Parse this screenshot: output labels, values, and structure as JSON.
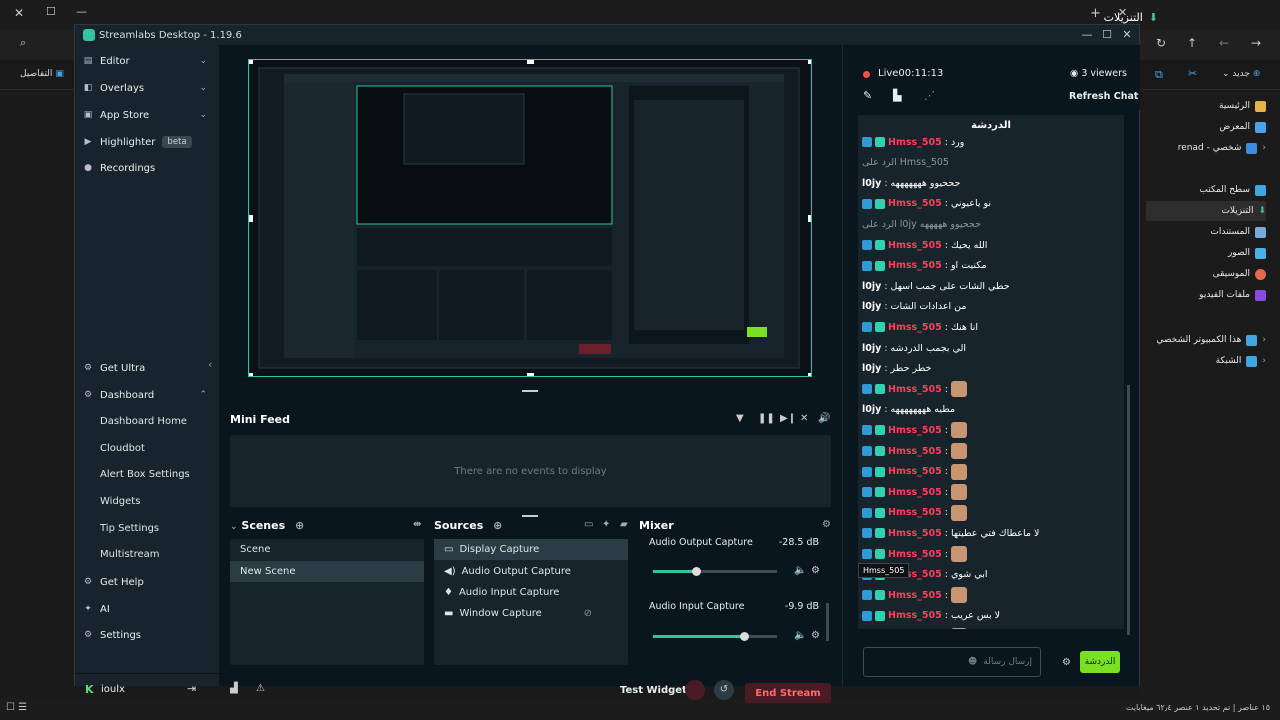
{
  "explorer": {
    "tab_title": "التنزيلات",
    "toolbar_new": "جديد",
    "details_label": "التفاصيل",
    "sidebar": [
      {
        "label": "الرئيسية"
      },
      {
        "label": "المعرض"
      },
      {
        "label": "renad - شخصي"
      },
      {
        "label": "سطح المكتب"
      },
      {
        "label": "التنزيلات"
      },
      {
        "label": "المستندات"
      },
      {
        "label": "الصور"
      },
      {
        "label": "الموسيقى"
      },
      {
        "label": "ملفات الفيديو"
      },
      {
        "label": "هذا الكمبيوتر الشخصي"
      },
      {
        "label": "الشبكة"
      }
    ],
    "status": "١٥ عناصر  |  تم تحديد ١ عنصر ٦٢٫٤ ميغابايت"
  },
  "app": {
    "title": "Streamlabs Desktop - 1.19.6",
    "nav": {
      "editor": "Editor",
      "overlays": "Overlays",
      "app_store": "App Store",
      "highlighter": "Highlighter",
      "beta": "beta",
      "recordings": "Recordings",
      "get_ultra": "Get Ultra",
      "dashboard": "Dashboard",
      "dashboard_sub": [
        "Dashboard Home",
        "Cloudbot",
        "Alert Box Settings",
        "Widgets",
        "Tip Settings",
        "Multistream"
      ],
      "get_help": "Get Help",
      "ai": "AI",
      "settings": "Settings",
      "user": "ioulx"
    },
    "minifeed": {
      "title": "Mini Feed",
      "empty": "There are no events to display"
    },
    "scenes": {
      "title": "Scenes",
      "items": [
        {
          "label": "Scene"
        },
        {
          "label": "New Scene"
        }
      ]
    },
    "sources": {
      "title": "Sources",
      "items": [
        {
          "label": "Display Capture"
        },
        {
          "label": "Audio Output Capture"
        },
        {
          "label": "Audio Input Capture"
        },
        {
          "label": "Window Capture"
        }
      ]
    },
    "mixer": {
      "title": "Mixer",
      "channels": [
        {
          "label": "Audio Output Capture",
          "db": "-28.5 dB",
          "level": 0.35
        },
        {
          "label": "Audio Input Capture",
          "db": "-9.9 dB",
          "level": 0.73
        }
      ]
    },
    "footer": {
      "test_widgets": "Test Widgets",
      "end_stream": "End Stream"
    }
  },
  "chat": {
    "live": "Live",
    "time": "00:11:13",
    "viewers": "3 viewers",
    "refresh": "Refresh Chat",
    "title": "الدردشة",
    "messages": [
      {
        "user": "Hmss_505",
        "text": "ورد"
      },
      {
        "user": "",
        "text": "الرد على Hmss_505"
      },
      {
        "user": "l0jy",
        "text": "حححيوو هههههههه"
      },
      {
        "user": "Hmss_505",
        "text": "نو ياعيوني"
      },
      {
        "user": "",
        "text": "الرد على l0jy حححيوو هههههه"
      },
      {
        "user": "Hmss_505",
        "text": "الله يحيك"
      },
      {
        "user": "Hmss_505",
        "text": "مكنيت او"
      },
      {
        "user": "l0jy",
        "text": "حطي الشات على جمب اسهل"
      },
      {
        "user": "l0jy",
        "text": "من اعدادات الشات"
      },
      {
        "user": "Hmss_505",
        "text": "انا هنك"
      },
      {
        "user": "l0jy",
        "text": "الي بجمب الدردشه"
      },
      {
        "user": "l0jy",
        "text": "خطر حطر"
      },
      {
        "user": "Hmss_505",
        "text": ""
      },
      {
        "user": "l0jy",
        "text": "مطيه ههههههههه"
      },
      {
        "user": "Hmss_505",
        "text": ""
      },
      {
        "user": "Hmss_505",
        "text": ""
      },
      {
        "user": "Hmss_505",
        "text": ""
      },
      {
        "user": "Hmss_505",
        "text": ""
      },
      {
        "user": "Hmss_505",
        "text": ""
      },
      {
        "user": "Hmss_505",
        "text": "لا ماعطاك فتي عطيتها"
      },
      {
        "user": "Hmss_505",
        "text": ""
      },
      {
        "user": "Hmss_505",
        "text": "ابي شوي"
      },
      {
        "user": "Hmss_505",
        "text": ""
      },
      {
        "user": "Hmss_505",
        "text": "لا بس عريب"
      },
      {
        "user": "Hmss_505",
        "text": ""
      }
    ],
    "tooltip": "Hmss_505",
    "input_placeholder": "إرسال رسالة",
    "send": "الدردشة"
  }
}
